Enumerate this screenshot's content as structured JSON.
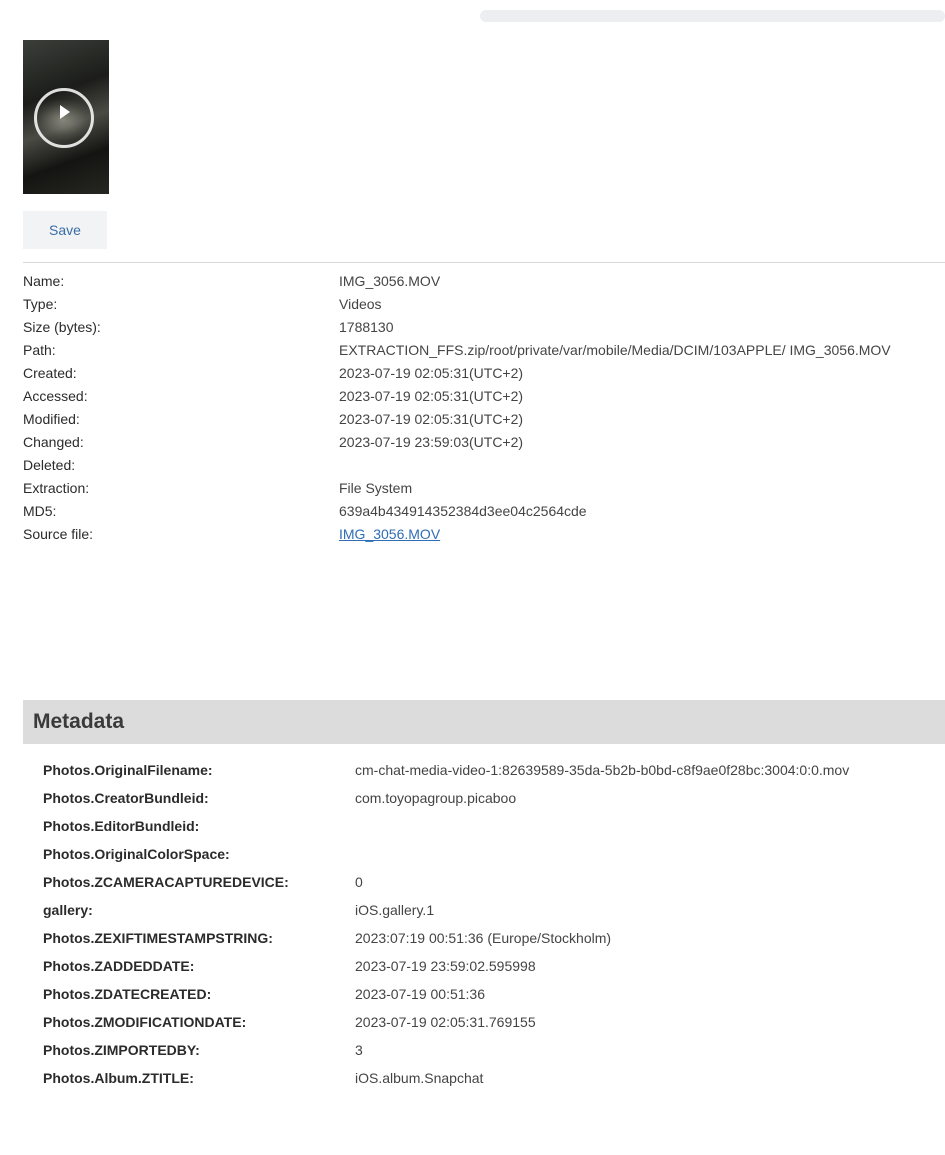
{
  "save_label": "Save",
  "properties": [
    {
      "label": "Name:",
      "value": "IMG_3056.MOV"
    },
    {
      "label": "Type:",
      "value": "Videos"
    },
    {
      "label": "Size (bytes):",
      "value": "1788130"
    },
    {
      "label": "Path:",
      "value": "EXTRACTION_FFS.zip/root/private/var/mobile/Media/DCIM/103APPLE/ IMG_3056.MOV"
    },
    {
      "label": "Created:",
      "value": "2023-07-19 02:05:31(UTC+2)"
    },
    {
      "label": "Accessed:",
      "value": "2023-07-19 02:05:31(UTC+2)"
    },
    {
      "label": "Modified:",
      "value": "2023-07-19 02:05:31(UTC+2)"
    },
    {
      "label": "Changed:",
      "value": "2023-07-19 23:59:03(UTC+2)"
    },
    {
      "label": "Deleted:",
      "value": ""
    },
    {
      "label": "Extraction:",
      "value": "File System"
    },
    {
      "label": "MD5:",
      "value": "639a4b434914352384d3ee04c2564cde"
    },
    {
      "label": "Source file:",
      "value": "IMG_3056.MOV"
    }
  ],
  "metadata_title": "Metadata",
  "metadata": [
    {
      "label": "Photos.OriginalFilename:",
      "value": "cm-chat-media-video-1:82639589-35da-5b2b-b0bd-c8f9ae0f28bc:3004:0:0.mov"
    },
    {
      "label": "Photos.CreatorBundleid:",
      "value": "com.toyopagroup.picaboo"
    },
    {
      "label": "Photos.EditorBundleid:",
      "value": ""
    },
    {
      "label": "Photos.OriginalColorSpace:",
      "value": ""
    },
    {
      "label": "Photos.ZCAMERACAPTUREDEVICE:",
      "value": "0"
    },
    {
      "label": "gallery:",
      "value": "iOS.gallery.1"
    },
    {
      "label": "Photos.ZEXIFTIMESTAMPSTRING:",
      "value": "2023:07:19 00:51:36 (Europe/Stockholm)"
    },
    {
      "label": "Photos.ZADDEDDATE:",
      "value": "2023-07-19 23:59:02.595998"
    },
    {
      "label": "Photos.ZDATECREATED:",
      "value": "2023-07-19 00:51:36"
    },
    {
      "label": "Photos.ZMODIFICATIONDATE:",
      "value": "2023-07-19 02:05:31.769155"
    },
    {
      "label": "Photos.ZIMPORTEDBY:",
      "value": "3"
    },
    {
      "label": "Photos.Album.ZTITLE:",
      "value": "iOS.album.Snapchat"
    }
  ]
}
